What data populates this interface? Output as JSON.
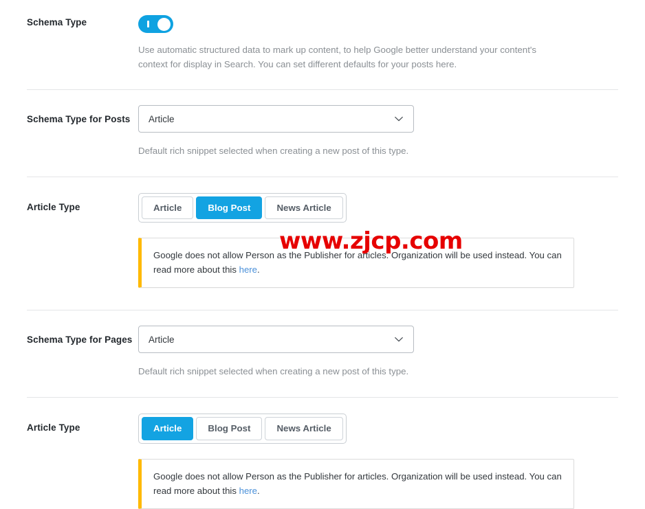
{
  "sections": [
    {
      "id": "schema-type",
      "label": "Schema Type",
      "toggle": {
        "state": "on",
        "aria": "Schema Type enabled"
      },
      "helptext": "Use automatic structured data to mark up content, to help Google better understand your content's context for display in Search. You can set different defaults for your posts here."
    },
    {
      "id": "schema-type-posts",
      "label": "Schema Type for Posts",
      "select": {
        "value": "Article",
        "icon": "chevron-down-icon"
      },
      "helptext": "Default rich snippet selected when creating a new post of this type."
    },
    {
      "id": "article-type-posts",
      "label": "Article Type",
      "buttons": [
        {
          "label": "Article",
          "active": false
        },
        {
          "label": "Blog Post",
          "active": true
        },
        {
          "label": "News Article",
          "active": false
        }
      ],
      "notice": {
        "text_before": "Google does not allow Person as the Publisher for articles. Organization will be used instead. You can read more about this ",
        "link": "here",
        "text_after": "."
      }
    },
    {
      "id": "schema-type-pages",
      "label": "Schema Type for Pages",
      "select": {
        "value": "Article",
        "icon": "chevron-down-icon"
      },
      "helptext": "Default rich snippet selected when creating a new post of this type."
    },
    {
      "id": "article-type-pages",
      "label": "Article Type",
      "buttons": [
        {
          "label": "Article",
          "active": true
        },
        {
          "label": "Blog Post",
          "active": false
        },
        {
          "label": "News Article",
          "active": false
        }
      ],
      "notice": {
        "text_before": "Google does not allow Person as the Publisher for articles. Organization will be used instead. You can read more about this ",
        "link": "here",
        "text_after": "."
      }
    }
  ],
  "watermark": {
    "text": "www.zjcp.com",
    "color": "#e60000"
  },
  "colors": {
    "accent_blue": "#13a3e2",
    "notice_border": "#ffb900",
    "link_blue": "#4a90d9",
    "help_gray": "#8a8f94"
  }
}
